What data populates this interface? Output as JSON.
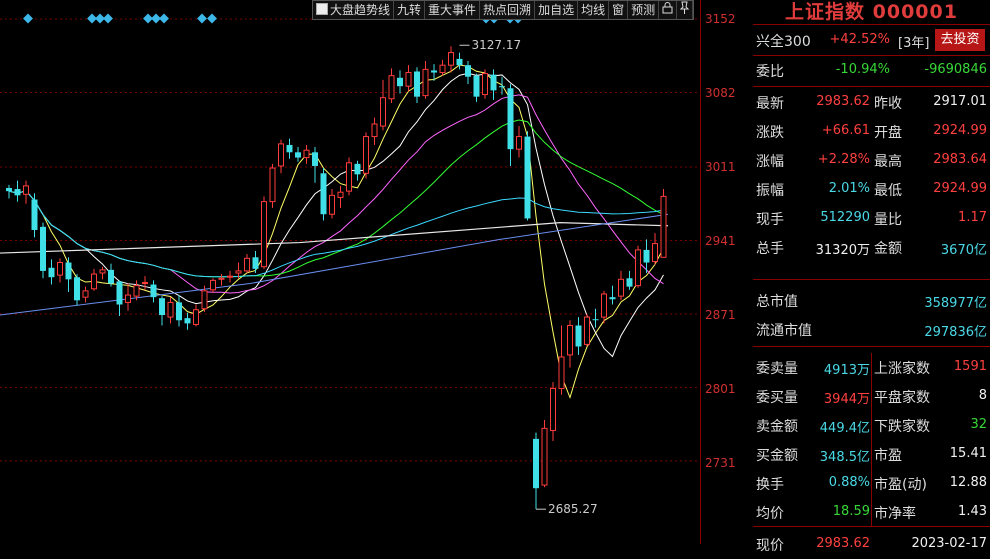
{
  "toolbar": {
    "items": [
      "大盘趋势线",
      "九转",
      "重大事件",
      "热点回溯",
      "加自选",
      "均线",
      "窗",
      "预测"
    ],
    "lock_icon": "lock-icon",
    "pin_icon": "pin-icon"
  },
  "price_axis": {
    "ticks": [
      "3152",
      "3082",
      "3011",
      "2941",
      "2871",
      "2801",
      "2731"
    ]
  },
  "annotations": {
    "high": "3127.17",
    "low": "2685.27"
  },
  "chart": {
    "candles": [
      [
        2991,
        2988,
        2981,
        2994
      ],
      [
        2990,
        2984,
        2978,
        2998
      ],
      [
        2985,
        2993,
        2976,
        2998
      ],
      [
        2980,
        2951,
        2944,
        2986
      ],
      [
        2954,
        2912,
        2905,
        2958
      ],
      [
        2915,
        2906,
        2899,
        2923
      ],
      [
        2908,
        2920,
        2901,
        2924
      ],
      [
        2920,
        2904,
        2892,
        2925
      ],
      [
        2906,
        2884,
        2879,
        2909
      ],
      [
        2887,
        2893,
        2882,
        2897
      ],
      [
        2895,
        2909,
        2893,
        2914
      ],
      [
        2910,
        2913,
        2904,
        2916
      ],
      [
        2913,
        2900,
        2897,
        2919
      ],
      [
        2902,
        2880,
        2869,
        2903
      ],
      [
        2882,
        2889,
        2874,
        2900
      ],
      [
        2888,
        2898,
        2884,
        2903
      ],
      [
        2900,
        2901,
        2894,
        2907
      ],
      [
        2899,
        2887,
        2882,
        2903
      ],
      [
        2886,
        2870,
        2860,
        2888
      ],
      [
        2868,
        2882,
        2862,
        2887
      ],
      [
        2882,
        2865,
        2859,
        2889
      ],
      [
        2867,
        2862,
        2856,
        2872
      ],
      [
        2861,
        2875,
        2859,
        2880
      ],
      [
        2876,
        2893,
        2873,
        2898
      ],
      [
        2894,
        2903,
        2891,
        2905
      ],
      [
        2904,
        2905,
        2898,
        2909
      ],
      [
        2906,
        2907,
        2901,
        2912
      ],
      [
        2910,
        2912,
        2905,
        2920
      ],
      [
        2912,
        2924,
        2910,
        2928
      ],
      [
        2925,
        2914,
        2910,
        2931
      ],
      [
        2916,
        2978,
        2914,
        2983
      ],
      [
        2978,
        3010,
        2972,
        3014
      ],
      [
        3012,
        3033,
        3005,
        3037
      ],
      [
        3032,
        3025,
        3019,
        3038
      ],
      [
        3025,
        3020,
        3016,
        3030
      ],
      [
        3020,
        3027,
        3014,
        3032
      ],
      [
        3025,
        3012,
        2996,
        3030
      ],
      [
        3005,
        2966,
        2960,
        3010
      ],
      [
        2966,
        2984,
        2962,
        2990
      ],
      [
        2982,
        2987,
        2972,
        2993
      ],
      [
        2988,
        3015,
        2984,
        3020
      ],
      [
        3014,
        3004,
        2998,
        3017
      ],
      [
        3005,
        3040,
        3000,
        3044
      ],
      [
        3040,
        3052,
        3032,
        3058
      ],
      [
        3050,
        3077,
        3046,
        3094
      ],
      [
        3076,
        3098,
        3072,
        3105
      ],
      [
        3096,
        3088,
        3081,
        3103
      ],
      [
        3088,
        3101,
        3083,
        3108
      ],
      [
        3102,
        3078,
        3072,
        3106
      ],
      [
        3079,
        3104,
        3076,
        3112
      ],
      [
        3103,
        3101,
        3093,
        3109
      ],
      [
        3101,
        3108,
        3098,
        3113
      ],
      [
        3108,
        3120,
        3101,
        3126
      ],
      [
        3114,
        3108,
        3104,
        3120
      ],
      [
        3108,
        3097,
        3090,
        3112
      ],
      [
        3098,
        3078,
        3073,
        3100
      ],
      [
        3080,
        3100,
        3076,
        3104
      ],
      [
        3099,
        3084,
        3075,
        3104
      ],
      [
        3088,
        3087,
        3080,
        3097
      ],
      [
        3086,
        3028,
        3012,
        3090
      ],
      [
        3028,
        3040,
        3020,
        3050
      ],
      [
        3040,
        2962,
        2960,
        3045
      ],
      [
        2752,
        2705,
        2685,
        2758
      ],
      [
        2708,
        2762,
        2706,
        2770
      ],
      [
        2760,
        2800,
        2750,
        2806
      ],
      [
        2800,
        2830,
        2794,
        2860
      ],
      [
        2832,
        2860,
        2820,
        2865
      ],
      [
        2860,
        2840,
        2832,
        2868
      ],
      [
        2842,
        2868,
        2840,
        2871
      ],
      [
        2866,
        2865,
        2858,
        2876
      ],
      [
        2868,
        2890,
        2862,
        2893
      ],
      [
        2887,
        2885,
        2880,
        2898
      ],
      [
        2888,
        2904,
        2884,
        2912
      ],
      [
        2905,
        2897,
        2894,
        2912
      ],
      [
        2898,
        2932,
        2896,
        2936
      ],
      [
        2932,
        2920,
        2910,
        2942
      ],
      [
        2921,
        2938,
        2918,
        2948
      ],
      [
        2925,
        2983,
        2925,
        2990
      ]
    ]
  },
  "panel": {
    "title": "上证指数 000001",
    "rows": [
      {
        "label": "兴全300",
        "v1": "+42.52%",
        "v2": "[3年]",
        "button": "去投资"
      },
      {
        "label": "委比",
        "v1": "-10.94%",
        "v2": "-9690846"
      },
      {
        "label": "最新",
        "v1": "2983.62",
        "label2": "昨收",
        "v2": "2917.01"
      },
      {
        "label": "涨跌",
        "v1": "+66.61",
        "label2": "开盘",
        "v2": "2924.99"
      },
      {
        "label": "涨幅",
        "v1": "+2.28%",
        "label2": "最高",
        "v2": "2983.64"
      },
      {
        "label": "振幅",
        "v1": "2.01%",
        "label2": "最低",
        "v2": "2924.99"
      },
      {
        "label": "现手",
        "v1": "512290",
        "label2": "量比",
        "v2": "1.17"
      },
      {
        "label": "总手",
        "v1": "31320万",
        "label2": "金额",
        "v2": "3670亿"
      },
      {
        "label": "总市值",
        "v2": "358977亿"
      },
      {
        "label": "流通市值",
        "v2": "297836亿"
      },
      {
        "label": "委卖量",
        "v1": "4913万",
        "label2": "上涨家数",
        "v2": "1591"
      },
      {
        "label": "委买量",
        "v1": "3944万",
        "label2": "平盘家数",
        "v2": "8"
      },
      {
        "label": "卖金额",
        "v1": "449.4亿",
        "label2": "下跌家数",
        "v2": "32"
      },
      {
        "label": "买金额",
        "v1": "348.5亿",
        "label2": "市盈",
        "v2": "15.41"
      },
      {
        "label": "换手",
        "v1": "0.88%",
        "label2": "市盈(动)",
        "v2": "12.88"
      },
      {
        "label": "均价",
        "v1": "18.59",
        "label2": "市净率",
        "v2": "1.43"
      },
      {
        "label": "现价",
        "v1": "2983.62",
        "label2": "",
        "v2": "2023-02-17"
      }
    ]
  },
  "colors": {
    "up": "#ff3c3c",
    "down": "#40e0e8",
    "grid": "#7a0000",
    "bg": "#000000"
  }
}
